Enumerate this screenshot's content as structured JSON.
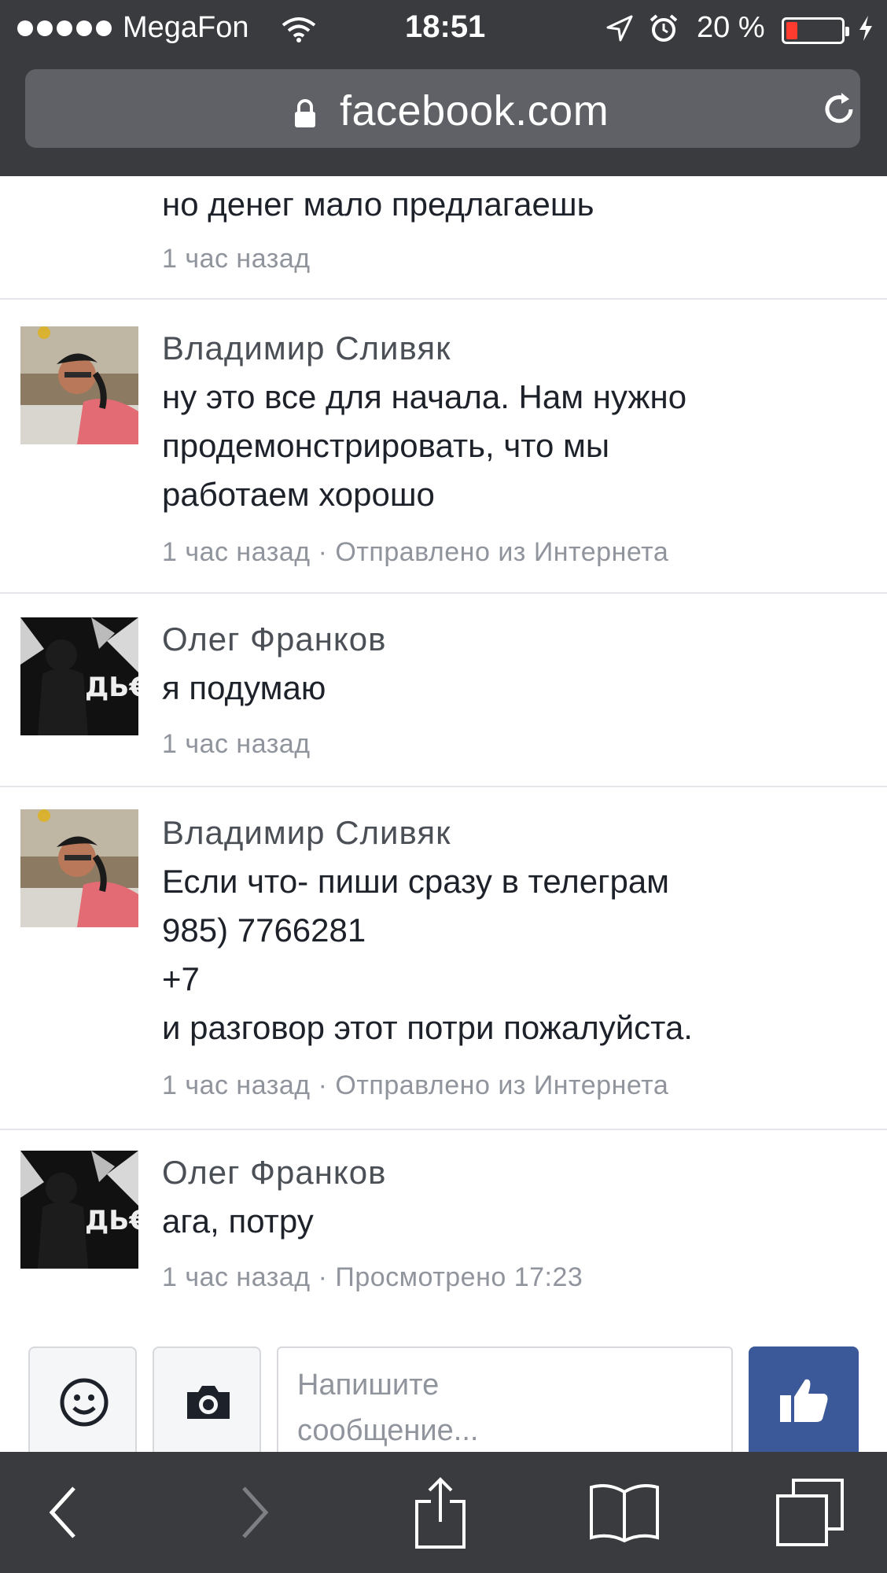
{
  "status_bar": {
    "carrier": "MegaFon",
    "time": "18:51",
    "battery_percent": "20 %",
    "battery_level": 0.2,
    "signal_bars": 5,
    "battery_color": "#ff3b30"
  },
  "browser": {
    "url": "facebook.com"
  },
  "messages": [
    {
      "sender": "",
      "lines": [
        "но денег мало предлагаешь"
      ],
      "time": "1 час назад",
      "extra": ""
    },
    {
      "sender": "Владимир Сливяк",
      "avatar": "vladimir-avatar",
      "lines": [
        "ну это все для начала. Нам нужно",
        "продемонстрировать, что мы",
        "работаем хорошо"
      ],
      "time": "1 час назад",
      "extra": "Отправлено из Интернета"
    },
    {
      "sender": "Олег Франков",
      "avatar": "oleg-avatar",
      "lines": [
        "я подумаю"
      ],
      "time": "1 час назад",
      "extra": ""
    },
    {
      "sender": "Владимир Сливяк",
      "avatar": "vladimir-avatar",
      "lines": [
        "Если что- пиши сразу в телеграм",
        "985) 7766281",
        "+7",
        "и разговор этот потри пожалуйста."
      ],
      "time": "1 час назад",
      "extra": "Отправлено из Интернета"
    },
    {
      "sender": "Олег Франков",
      "avatar": "oleg-avatar",
      "lines": [
        "ага, потру"
      ],
      "time": "1 час назад",
      "extra": "Просмотрено 17:23"
    }
  ],
  "meta_separator": "·",
  "compose": {
    "placeholder_line1": "Напишите",
    "placeholder_line2": "сообщение..."
  },
  "theme": {
    "facebook_blue": "#3b5998",
    "browser_chrome": "#393b3f"
  },
  "icons": {
    "emoji": "smiley-icon",
    "camera": "camera-icon",
    "like": "thumbs-up-icon",
    "back": "back-arrow-icon",
    "forward": "forward-arrow-icon",
    "share": "share-icon",
    "bookmarks": "book-icon",
    "tabs": "tabs-icon"
  }
}
